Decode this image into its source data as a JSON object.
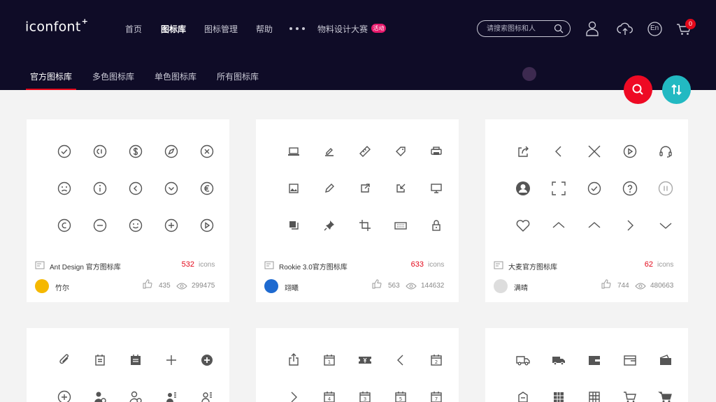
{
  "header": {
    "logo_text": "iconfont",
    "logo_plus": "+",
    "nav": [
      {
        "label": "首页",
        "active": false
      },
      {
        "label": "图标库",
        "active": true
      },
      {
        "label": "图标管理",
        "active": false
      },
      {
        "label": "帮助",
        "active": false
      },
      {
        "label": "物料设计大赛",
        "active": false
      }
    ],
    "badge": "活动",
    "search_placeholder": "请搜索图标和人",
    "lang": "En",
    "cart_count": "0"
  },
  "subnav": [
    {
      "label": "官方图标库",
      "active": true
    },
    {
      "label": "多色图标库",
      "active": false
    },
    {
      "label": "单色图标库",
      "active": false
    },
    {
      "label": "所有图标库",
      "active": false
    }
  ],
  "colors": {
    "header_bg": "#0f0c27",
    "accent_red": "#e3081a",
    "teal": "#22b9c2",
    "badge_pink": "#e8196c"
  },
  "cards": [
    {
      "title": "Ant Design 官方图标库",
      "count": "532",
      "unit": "icons",
      "author": "竹尔",
      "likes": "435",
      "views": "299475",
      "avatar_color": "#f5b800",
      "icons": [
        "check-circle-icon",
        "copyright-cl-icon",
        "dollar-circle-icon",
        "compass-icon",
        "close-circle-icon",
        "frown-icon",
        "info-circle-icon",
        "left-circle-icon",
        "down-circle-icon",
        "euro-circle-icon",
        "copyright-icon",
        "minus-circle-icon",
        "smile-icon",
        "plus-circle-icon",
        "play-circle-icon"
      ]
    },
    {
      "title": "Rookie 3.0官方图标库",
      "count": "633",
      "unit": "icons",
      "author": "翊曦",
      "likes": "563",
      "views": "144632",
      "avatar_color": "#1e6ad0",
      "icons": [
        "laptop-icon",
        "edit-line-icon",
        "ruler-icon",
        "tag-icon",
        "printer-icon",
        "image-icon",
        "pencil-icon",
        "export-icon",
        "import-icon",
        "monitor-icon",
        "copy-icon",
        "pin-icon",
        "crop-icon",
        "keyboard-icon",
        "lock-icon"
      ]
    },
    {
      "title": "大麦官方图标库",
      "count": "62",
      "unit": "icons",
      "author": "满晴",
      "likes": "744",
      "views": "480663",
      "avatar_color": "#dddddd",
      "icons": [
        "share-icon",
        "chevron-left-icon",
        "close-icon",
        "play-circle-icon",
        "headset-icon",
        "user-circle-icon",
        "scan-frame-icon",
        "check-circle-icon",
        "question-circle-icon",
        "pause-circle-icon",
        "heart-icon",
        "chevron-up-icon",
        "chevron-up-icon",
        "chevron-right-icon",
        "chevron-down-icon"
      ]
    },
    {
      "icons": [
        "paperclip-icon",
        "calendar-list-icon",
        "calendar-filled-icon",
        "plus-icon",
        "plus-circle-filled-icon",
        "plus-circle-icon",
        "user-add-icon",
        "user-settings-icon",
        "contact-card-icon",
        "contact-card-outline-icon"
      ]
    },
    {
      "icons": [
        "upload-icon",
        "calendar-1-icon",
        "yen-ticket-icon",
        "chevron-left-icon",
        "calendar-2-icon",
        "chevron-right-icon",
        "calendar-4-icon",
        "calendar-3-icon",
        "calendar-5-icon",
        "calendar-7-icon"
      ]
    },
    {
      "icons": [
        "truck-icon",
        "truck-filled-icon",
        "wallet-filled-icon",
        "wallet-icon",
        "purse-icon",
        "box-icon",
        "grid-building-icon",
        "building-icon",
        "cart-icon",
        "cart-filled-icon"
      ]
    }
  ]
}
